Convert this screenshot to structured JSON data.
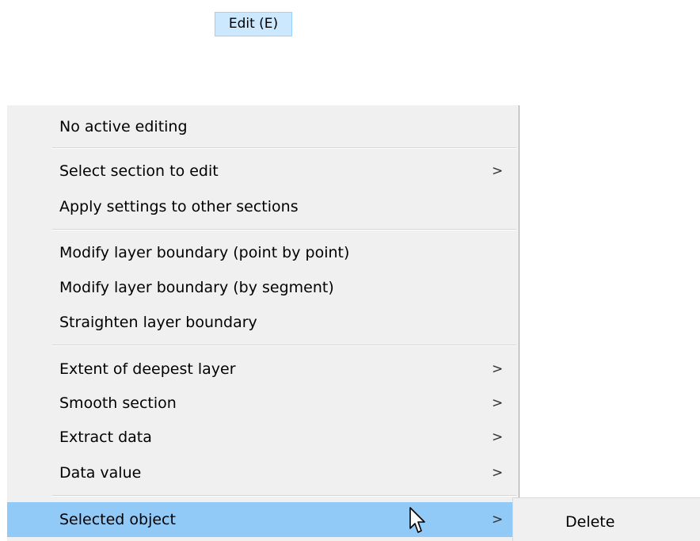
{
  "menubar": {
    "active_item": "Edit (E)"
  },
  "menu": {
    "items": [
      {
        "label": "No active editing",
        "has_submenu": false
      },
      {
        "label": "Select section to edit",
        "has_submenu": true
      },
      {
        "label": "Apply settings to other sections",
        "has_submenu": false
      },
      {
        "label": "Modify layer boundary (point by point)",
        "has_submenu": false
      },
      {
        "label": "Modify layer boundary (by segment)",
        "has_submenu": false
      },
      {
        "label": "Straighten layer boundary",
        "has_submenu": false
      },
      {
        "label": "Extent of deepest layer",
        "has_submenu": true
      },
      {
        "label": "Smooth section",
        "has_submenu": true
      },
      {
        "label": "Extract data",
        "has_submenu": true
      },
      {
        "label": "Data value",
        "has_submenu": true
      },
      {
        "label": "Selected object",
        "has_submenu": true,
        "selected": true
      }
    ],
    "arrow_glyph": ">"
  },
  "submenu": {
    "items": [
      {
        "label": "Delete"
      }
    ]
  },
  "colors": {
    "menu_background": "#f0f0f0",
    "selected_background": "#91c9f7",
    "menubar_highlight": "#cce8ff",
    "menubar_highlight_border": "#99d1ff"
  },
  "icons": {
    "cursor": "mouse-pointer-icon",
    "submenu_arrow": "chevron-right-icon"
  }
}
